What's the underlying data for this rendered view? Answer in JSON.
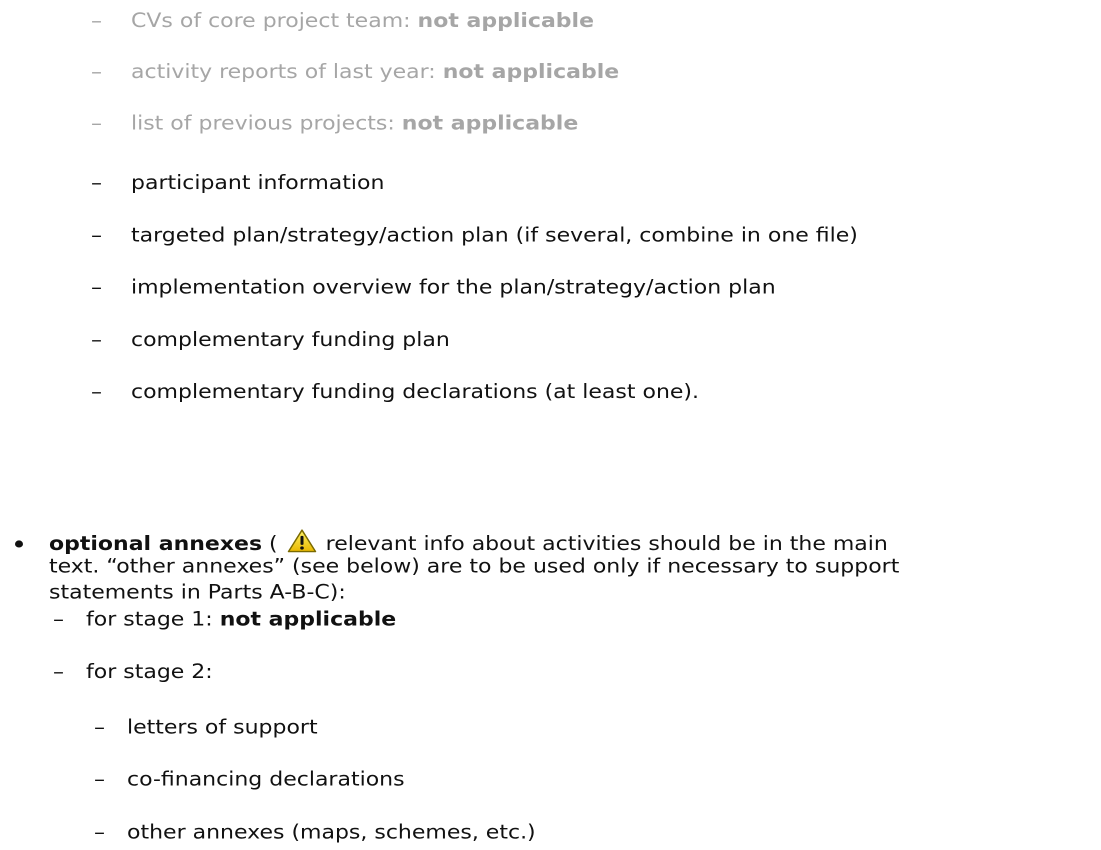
{
  "dash_glyph": "–",
  "grey_items": [
    {
      "label": "CVs of core project team:",
      "value": "not applicable"
    },
    {
      "label": "activity reports of last year:",
      "value": "not applicable"
    },
    {
      "label": "list of previous projects:",
      "value": "not applicable"
    }
  ],
  "items": [
    "participant information",
    "targeted plan/strategy/action plan (if several, combine in one file)",
    "implementation overview for the plan/strategy/action plan",
    "complementary funding plan",
    "complementary funding declarations (at least one)."
  ],
  "optional": {
    "title": "optional annexes",
    "open_paren": "(",
    "warning_icon": "warning-icon",
    "line1_rest": "relevant info about activities should be in the main",
    "line2": "text. “other annexes” (see below) are to be used only if necessary to support",
    "line3": "statements in Parts A-B-C):",
    "stage1_label": "for stage 1:",
    "stage1_value": "not applicable",
    "stage2_label": "for stage 2:",
    "stage2_items": [
      "letters of support",
      "co-financing declarations",
      "other annexes (maps, schemes, etc.)"
    ]
  }
}
